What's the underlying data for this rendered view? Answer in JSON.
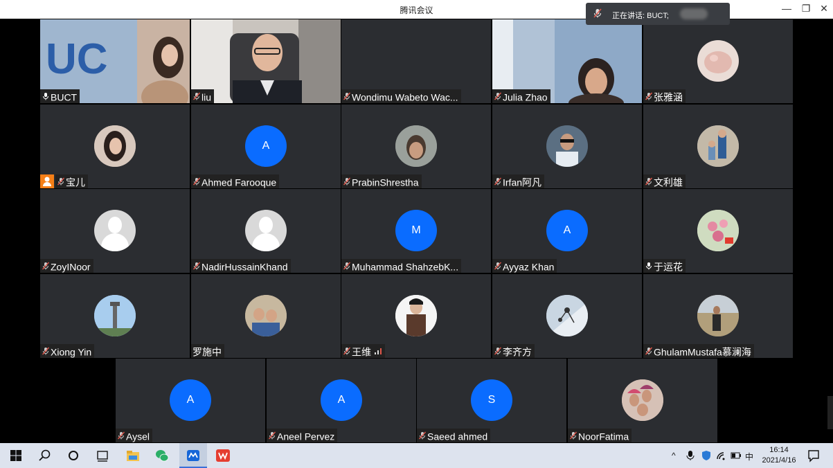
{
  "window": {
    "title": "腾讯会议",
    "controls": [
      "—",
      "❐",
      "✕"
    ]
  },
  "speaking_indicator": {
    "label": "正在讲话: BUCT;"
  },
  "participants": [
    {
      "name": "BUCT",
      "type": "video"
    },
    {
      "name": "liu",
      "type": "video"
    },
    {
      "name": "Wondimu Wabeto Wac...",
      "type": "blank"
    },
    {
      "name": "Julia Zhao",
      "type": "video"
    },
    {
      "name": "张雅涵",
      "type": "photo"
    },
    {
      "name": "宝儿",
      "type": "photo"
    },
    {
      "name": "Ahmed Farooque",
      "type": "letter",
      "letter": "A"
    },
    {
      "name": "PrabinShrestha",
      "type": "photo"
    },
    {
      "name": "Irfan阿凡",
      "type": "photo"
    },
    {
      "name": "文利雄",
      "type": "photo"
    },
    {
      "name": "ZoyINoor",
      "type": "default"
    },
    {
      "name": "NadirHussainKhand",
      "type": "default"
    },
    {
      "name": "Muhammad ShahzebK...",
      "type": "letter",
      "letter": "M"
    },
    {
      "name": "Ayyaz Khan",
      "type": "letter",
      "letter": "A"
    },
    {
      "name": "于运花",
      "type": "photo"
    },
    {
      "name": "Xiong Yin",
      "type": "photo"
    },
    {
      "name": "罗施中",
      "type": "photo"
    },
    {
      "name": "王维",
      "type": "photo"
    },
    {
      "name": "李齐方",
      "type": "photo"
    },
    {
      "name": "GhulamMustafa慕澜海",
      "type": "photo"
    },
    {
      "name": "Aysel",
      "type": "letter",
      "letter": "A"
    },
    {
      "name": "Aneel Pervez",
      "type": "letter",
      "letter": "A"
    },
    {
      "name": "Saeed ahmed",
      "type": "letter",
      "letter": "S"
    },
    {
      "name": "NoorFatima",
      "type": "photo"
    }
  ],
  "taskbar": {
    "time": "16:14",
    "date": "2021/4/16",
    "ime": "中"
  },
  "colors": {
    "accent": "#0a6cff",
    "tile": "#2b2d31",
    "active_border": "#2ecc71",
    "mute": "#e0564a"
  }
}
